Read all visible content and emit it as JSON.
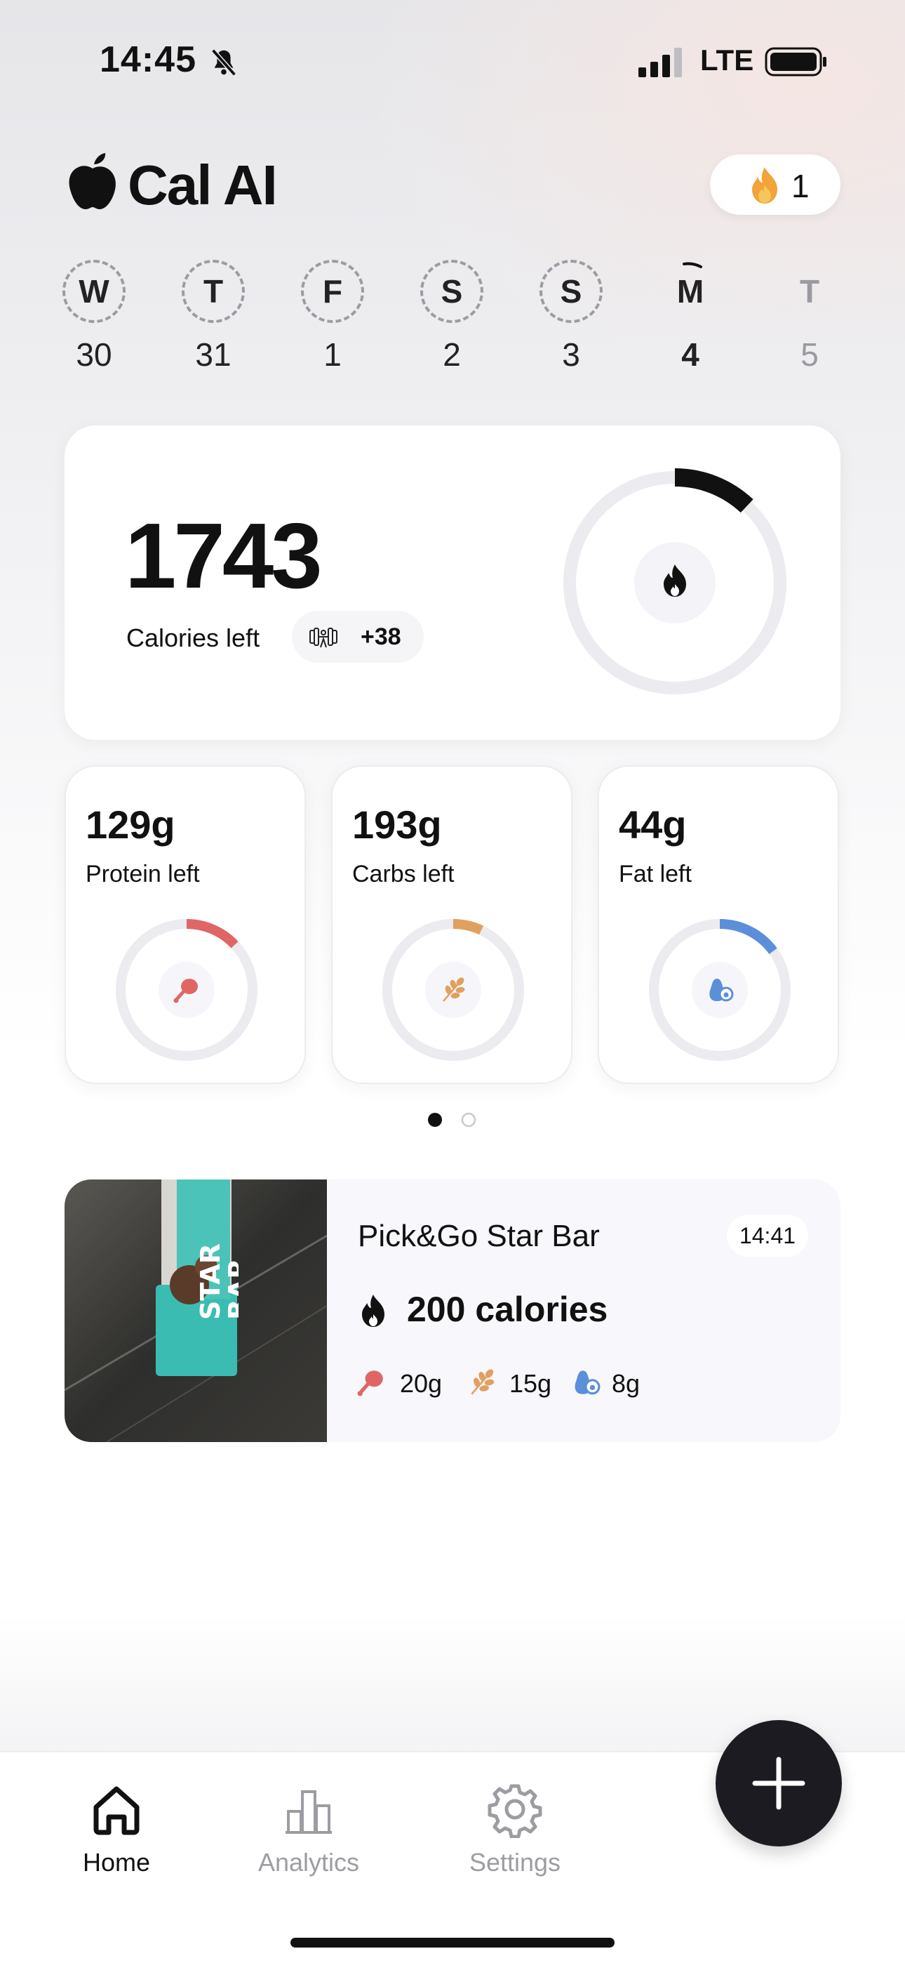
{
  "status": {
    "time": "14:45",
    "network": "LTE"
  },
  "header": {
    "title": "Cal AI",
    "streak": "1"
  },
  "week": [
    {
      "letter": "W",
      "date": "30",
      "state": "past"
    },
    {
      "letter": "T",
      "date": "31",
      "state": "past"
    },
    {
      "letter": "F",
      "date": "1",
      "state": "past"
    },
    {
      "letter": "S",
      "date": "2",
      "state": "past"
    },
    {
      "letter": "S",
      "date": "3",
      "state": "past"
    },
    {
      "letter": "M",
      "date": "4",
      "state": "today"
    },
    {
      "letter": "T",
      "date": "5",
      "state": "future"
    }
  ],
  "calories": {
    "value": "1743",
    "label": "Calories left",
    "burned": "+38",
    "progress": 0.12
  },
  "macros": [
    {
      "value": "129g",
      "label": "Protein left",
      "color": "#e06666",
      "progress": 0.13
    },
    {
      "value": "193g",
      "label": "Carbs left",
      "color": "#e0a060",
      "progress": 0.07
    },
    {
      "value": "44g",
      "label": "Fat left",
      "color": "#5b8fd9",
      "progress": 0.15
    }
  ],
  "meal": {
    "name": "Pick&Go Star Bar",
    "time": "14:41",
    "calories": "200 calories",
    "protein": "20g",
    "carbs": "15g",
    "fat": "8g",
    "photo_text": "STAR BAR"
  },
  "tabs": {
    "home": "Home",
    "analytics": "Analytics",
    "settings": "Settings"
  }
}
